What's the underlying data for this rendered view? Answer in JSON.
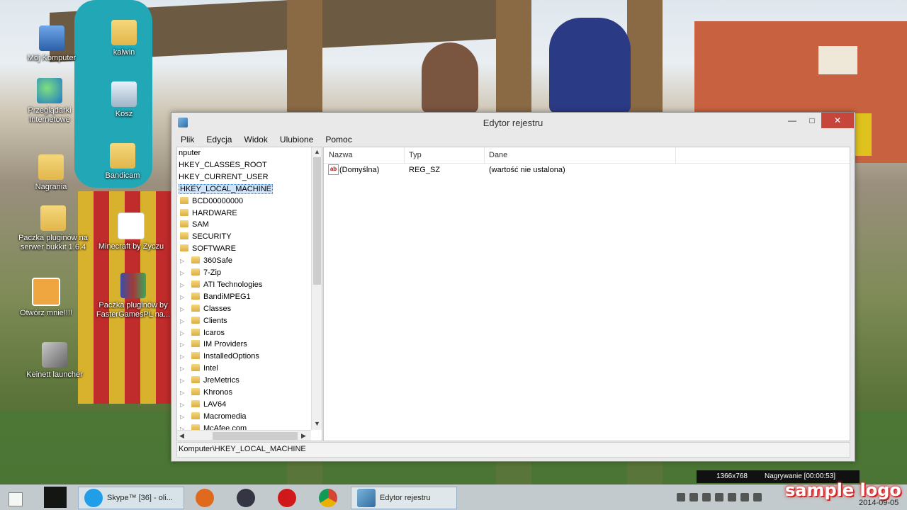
{
  "desktop": {
    "icons": [
      {
        "label": "Mój Komputer"
      },
      {
        "label": "kalwin"
      },
      {
        "label": "Przeglądarki Internetowe"
      },
      {
        "label": "Kosz"
      },
      {
        "label": "Nagrania"
      },
      {
        "label": "Bandicam"
      },
      {
        "label": "Paczka pluginów na serwer bukkit 1.6.4"
      },
      {
        "label": "Minecraft by Zyczu"
      },
      {
        "label": "Otwórz mnie!!!!"
      },
      {
        "label": "Paczka pluginów by FasterGamesPL na..."
      },
      {
        "label": "Keinett launcher"
      }
    ]
  },
  "window": {
    "title": "Edytor rejestru",
    "menu": [
      "Plik",
      "Edycja",
      "Widok",
      "Ulubione",
      "Pomoc"
    ],
    "tree": {
      "rows": [
        {
          "label": "nputer",
          "indent": 0
        },
        {
          "label": "HKEY_CLASSES_ROOT",
          "indent": 0
        },
        {
          "label": "HKEY_CURRENT_USER",
          "indent": 0
        },
        {
          "label": "HKEY_LOCAL_MACHINE",
          "indent": 0,
          "selected": true
        },
        {
          "label": "BCD00000000",
          "indent": 1
        },
        {
          "label": "HARDWARE",
          "indent": 1
        },
        {
          "label": "SAM",
          "indent": 1
        },
        {
          "label": "SECURITY",
          "indent": 1
        },
        {
          "label": "SOFTWARE",
          "indent": 1
        },
        {
          "label": "360Safe",
          "indent": 2
        },
        {
          "label": "7-Zip",
          "indent": 2
        },
        {
          "label": "ATI Technologies",
          "indent": 2
        },
        {
          "label": "BandiMPEG1",
          "indent": 2
        },
        {
          "label": "Classes",
          "indent": 2
        },
        {
          "label": "Clients",
          "indent": 2
        },
        {
          "label": "Icaros",
          "indent": 2
        },
        {
          "label": "IM Providers",
          "indent": 2
        },
        {
          "label": "InstalledOptions",
          "indent": 2
        },
        {
          "label": "Intel",
          "indent": 2
        },
        {
          "label": "JreMetrics",
          "indent": 2
        },
        {
          "label": "Khronos",
          "indent": 2
        },
        {
          "label": "LAV64",
          "indent": 2
        },
        {
          "label": "Macromedia",
          "indent": 2
        },
        {
          "label": "McAfee.com",
          "indent": 2
        }
      ]
    },
    "list": {
      "columns": [
        "Nazwa",
        "Typ",
        "Dane"
      ],
      "rows": [
        {
          "name": "(Domyślna)",
          "type": "REG_SZ",
          "data": "(wartość nie ustalona)"
        }
      ]
    },
    "status": "Komputer\\HKEY_LOCAL_MACHINE"
  },
  "taskbar": {
    "skype_label": "Skype™ [36] - oli...",
    "regedit_label": "Edytor rejestru"
  },
  "recorder": {
    "resolution": "1366x768",
    "recording": "Nagrywanie [00:00:53]"
  },
  "watermark": "sample logo",
  "clock": {
    "date": "2014-09-05"
  }
}
